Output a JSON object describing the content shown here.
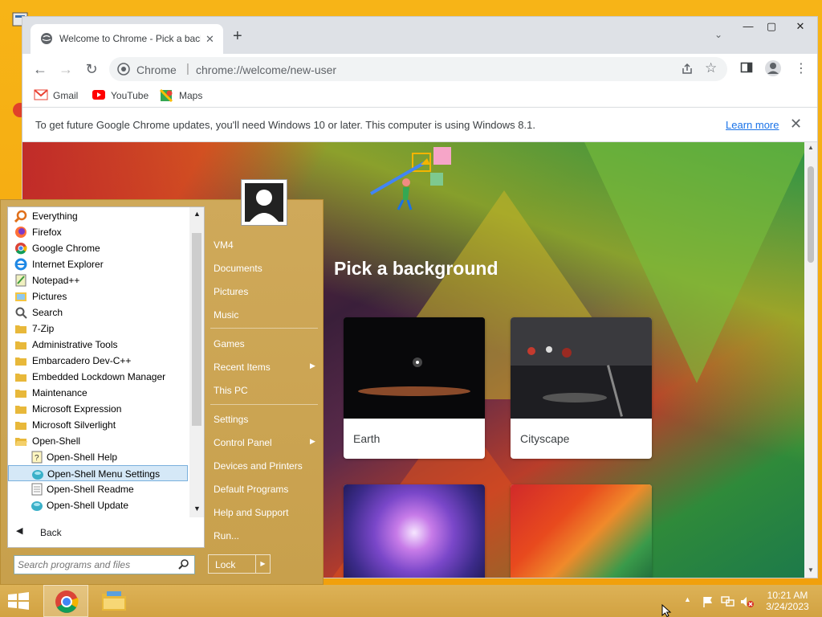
{
  "browser": {
    "tab_title": "Welcome to Chrome - Pick a background",
    "site_label": "Chrome",
    "url": "chrome://welcome/new-user",
    "bookmarks": [
      {
        "label": "Gmail",
        "icon": "gmail-icon"
      },
      {
        "label": "YouTube",
        "icon": "youtube-icon"
      },
      {
        "label": "Maps",
        "icon": "maps-icon"
      }
    ],
    "infobar": {
      "message": "To get future Google Chrome updates, you'll need Windows 10 or later. This computer is using Windows 8.1.",
      "link": "Learn more"
    },
    "page": {
      "title": "Pick a background",
      "cards": [
        {
          "label": "Earth"
        },
        {
          "label": "Cityscape"
        },
        {
          "label": ""
        },
        {
          "label": ""
        }
      ]
    }
  },
  "start_menu": {
    "programs": [
      {
        "label": "Everything",
        "icon": "everything-icon"
      },
      {
        "label": "Firefox",
        "icon": "firefox-icon"
      },
      {
        "label": "Google Chrome",
        "icon": "chrome-icon"
      },
      {
        "label": "Internet Explorer",
        "icon": "ie-icon"
      },
      {
        "label": "Notepad++",
        "icon": "notepad-icon"
      },
      {
        "label": "Pictures",
        "icon": "pictures-icon"
      },
      {
        "label": "Search",
        "icon": "search-icon"
      },
      {
        "label": "7-Zip",
        "icon": "folder-icon"
      },
      {
        "label": "Administrative Tools",
        "icon": "folder-icon"
      },
      {
        "label": "Embarcadero Dev-C++",
        "icon": "folder-icon"
      },
      {
        "label": "Embedded Lockdown Manager",
        "icon": "folder-icon"
      },
      {
        "label": "Maintenance",
        "icon": "folder-icon"
      },
      {
        "label": "Microsoft Expression",
        "icon": "folder-icon"
      },
      {
        "label": "Microsoft Silverlight",
        "icon": "folder-icon"
      },
      {
        "label": "Open-Shell",
        "icon": "folder-open-icon"
      }
    ],
    "open_shell_items": [
      {
        "label": "Open-Shell Help",
        "icon": "help-icon"
      },
      {
        "label": "Open-Shell Menu Settings",
        "icon": "shell-icon",
        "selected": true
      },
      {
        "label": "Open-Shell Readme",
        "icon": "document-icon"
      },
      {
        "label": "Open-Shell Update",
        "icon": "shell-icon"
      }
    ],
    "back_label": "Back",
    "search_placeholder": "Search programs and files",
    "right_items": [
      {
        "label": "VM4"
      },
      {
        "label": "Documents"
      },
      {
        "label": "Pictures"
      },
      {
        "label": "Music"
      },
      {
        "label": "Games"
      },
      {
        "label": "Recent Items",
        "submenu": true
      },
      {
        "label": "This PC"
      },
      {
        "label": "Settings"
      },
      {
        "label": "Control Panel",
        "submenu": true
      },
      {
        "label": "Devices and Printers"
      },
      {
        "label": "Default Programs"
      },
      {
        "label": "Help and Support"
      },
      {
        "label": "Run..."
      }
    ],
    "lock_label": "Lock"
  },
  "taskbar": {
    "time": "10:21 AM",
    "date": "3/24/2023"
  },
  "colors": {
    "desktop": "#f5ad12",
    "start_menu": "#c8a04c",
    "link": "#1a73e8",
    "selection": "#d5e8f7"
  }
}
